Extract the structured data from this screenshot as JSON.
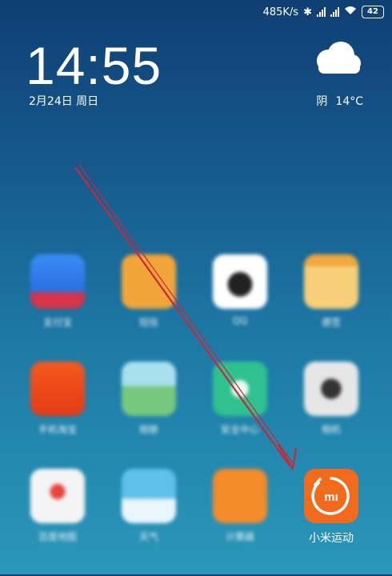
{
  "status_bar": {
    "network_speed": "485K/s",
    "battery": "42"
  },
  "clock": {
    "time": "14:55",
    "date": "2月24日 周日"
  },
  "weather": {
    "condition": "阴",
    "temperature": "14°C",
    "icon": "cloud-icon"
  },
  "apps": [
    {
      "label": "支付宝",
      "color": "#2d7ff0",
      "icon": "alipay-icon"
    },
    {
      "label": "短信",
      "color": "#f1a43a",
      "icon": "message-icon"
    },
    {
      "label": "QQ",
      "color": "#ffffff",
      "icon": "qq-penguin-icon"
    },
    {
      "label": "便签",
      "color": "#f4c261",
      "icon": "notes-icon"
    },
    {
      "label": "手机淘宝",
      "color": "#f04b1d",
      "icon": "taobao-icon"
    },
    {
      "label": "相册",
      "color": "#7ccf9a",
      "icon": "gallery-icon"
    },
    {
      "label": "安全中心",
      "color": "#2fc190",
      "icon": "shield-icon"
    },
    {
      "label": "相机",
      "color": "#e6e6e6",
      "icon": "camera-icon"
    },
    {
      "label": "百度地图",
      "color": "#f4f4f4",
      "icon": "map-icon"
    },
    {
      "label": "天气",
      "color": "#5fc0ea",
      "icon": "weather-app-icon"
    },
    {
      "label": "计算器",
      "color": "#f48b2a",
      "icon": "calculator-icon"
    },
    {
      "label": "小米运动",
      "color": "#f26a1b",
      "icon": "mi-fit-icon"
    }
  ],
  "colors": {
    "arrow": "#c8283a",
    "highlight_app": "#f26a1b"
  }
}
